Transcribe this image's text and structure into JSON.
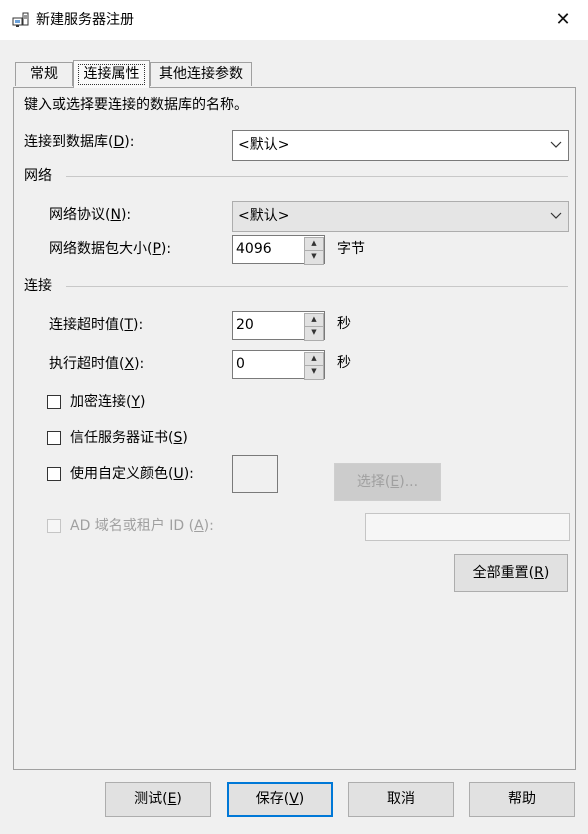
{
  "window": {
    "title": "新建服务器注册",
    "close_glyph": "✕"
  },
  "tabs": [
    {
      "label": "常规",
      "active": false
    },
    {
      "label": "连接属性",
      "active": true
    },
    {
      "label": "其他连接参数",
      "active": false
    }
  ],
  "panel": {
    "instruction": "键入或选择要连接的数据库的名称。",
    "connect_db": {
      "label": "连接到数据库(",
      "key": "D",
      "suffix": "):",
      "value": "<默认>"
    },
    "network": {
      "header": "网络",
      "protocol": {
        "label": "网络协议(",
        "key": "N",
        "suffix": "):",
        "value": "<默认>"
      },
      "packet_size": {
        "label": "网络数据包大小(",
        "key": "P",
        "suffix": "):",
        "value": "4096",
        "unit": "字节"
      }
    },
    "connection": {
      "header": "连接",
      "connect_timeout": {
        "label": "连接超时值(",
        "key": "T",
        "suffix": "):",
        "value": "20",
        "unit": "秒"
      },
      "exec_timeout": {
        "label": "执行超时值(",
        "key": "X",
        "suffix": "):",
        "value": "0",
        "unit": "秒"
      },
      "encrypt": {
        "label": "加密连接(",
        "key": "Y",
        "suffix": ")",
        "checked": false
      },
      "trust_cert": {
        "label": "信任服务器证书(",
        "key": "S",
        "suffix": ")",
        "checked": false
      },
      "custom_color": {
        "label": "使用自定义颜色(",
        "key": "U",
        "suffix": "):",
        "checked": false
      },
      "select_button": {
        "label": "选择(",
        "key": "E",
        "suffix": ")..."
      },
      "ad_domain": {
        "label": "AD 域名或租户 ID (",
        "key": "A",
        "suffix": "):",
        "value": ""
      }
    },
    "reset_button": {
      "label": "全部重置(",
      "key": "R",
      "suffix": ")"
    }
  },
  "footer": {
    "test": {
      "label": "测试(",
      "key": "E",
      "suffix": ")"
    },
    "save": {
      "label": "保存(",
      "key": "V",
      "suffix": ")"
    },
    "cancel": {
      "label": "取消"
    },
    "help": {
      "label": "帮助"
    }
  },
  "colors": {
    "dialog_bg": "#f0f0f0",
    "default_button_border": "#0078d7",
    "disabled_text": "#a0a0a0"
  }
}
